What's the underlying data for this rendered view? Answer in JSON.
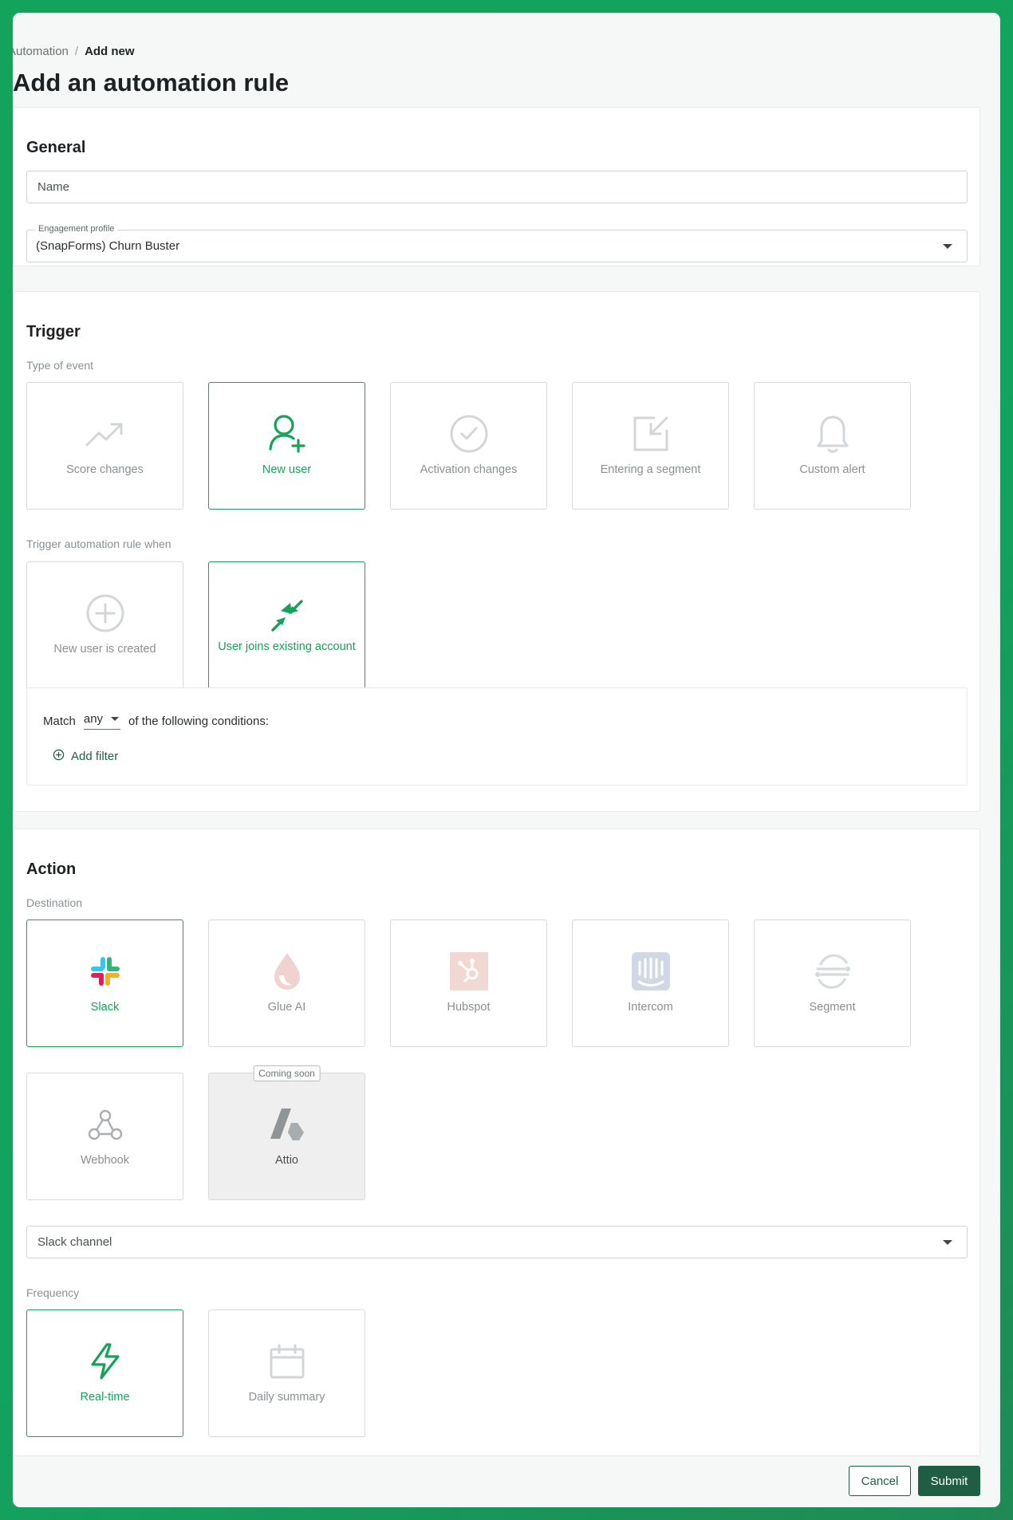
{
  "breadcrumb": {
    "parent": "Automation",
    "separator": "/",
    "current": "Add new"
  },
  "page_title": "Add an automation rule",
  "general": {
    "title": "General",
    "name_placeholder": "Name",
    "engagement_label": "Engagement profile",
    "engagement_value": "(SnapForms) Churn Buster"
  },
  "trigger": {
    "title": "Trigger",
    "event_label": "Type of event",
    "events": [
      {
        "label": "Score changes",
        "icon": "trending-up-icon",
        "selected": false
      },
      {
        "label": "New user",
        "icon": "add-user-icon",
        "selected": true
      },
      {
        "label": "Activation changes",
        "icon": "check-circle-icon",
        "selected": false
      },
      {
        "label": "Entering a segment",
        "icon": "enter-segment-icon",
        "selected": false
      },
      {
        "label": "Custom alert",
        "icon": "bell-icon",
        "selected": false
      }
    ],
    "when_label": "Trigger automation rule when",
    "when_options": [
      {
        "label": "New user is created",
        "icon": "plus-circle-icon",
        "selected": false
      },
      {
        "label": "User joins existing account",
        "icon": "arrows-in-icon",
        "selected": true
      }
    ],
    "conditions": {
      "match_prefix": "Match",
      "match_value": "any",
      "match_suffix": "of the following conditions:",
      "add_filter": "Add filter"
    }
  },
  "action": {
    "title": "Action",
    "destination_label": "Destination",
    "destinations": [
      {
        "label": "Slack",
        "icon": "slack-icon",
        "selected": true
      },
      {
        "label": "Glue AI",
        "icon": "glue-ai-icon",
        "selected": false
      },
      {
        "label": "Hubspot",
        "icon": "hubspot-icon",
        "selected": false
      },
      {
        "label": "Intercom",
        "icon": "intercom-icon",
        "selected": false
      },
      {
        "label": "Segment",
        "icon": "segment-icon",
        "selected": false
      },
      {
        "label": "Webhook",
        "icon": "webhook-icon",
        "selected": false
      },
      {
        "label": "Attio",
        "icon": "attio-icon",
        "selected": false,
        "disabled": true,
        "badge": "Coming soon"
      }
    ],
    "channel_placeholder": "Slack channel",
    "frequency_label": "Frequency",
    "frequencies": [
      {
        "label": "Real-time",
        "icon": "lightning-icon",
        "selected": true
      },
      {
        "label": "Daily summary",
        "icon": "calendar-icon",
        "selected": false
      }
    ]
  },
  "footer": {
    "cancel": "Cancel",
    "submit": "Submit"
  },
  "colors": {
    "accent": "#17a25a",
    "primary_button": "#1f5e45",
    "background": "#f6f7f7"
  }
}
